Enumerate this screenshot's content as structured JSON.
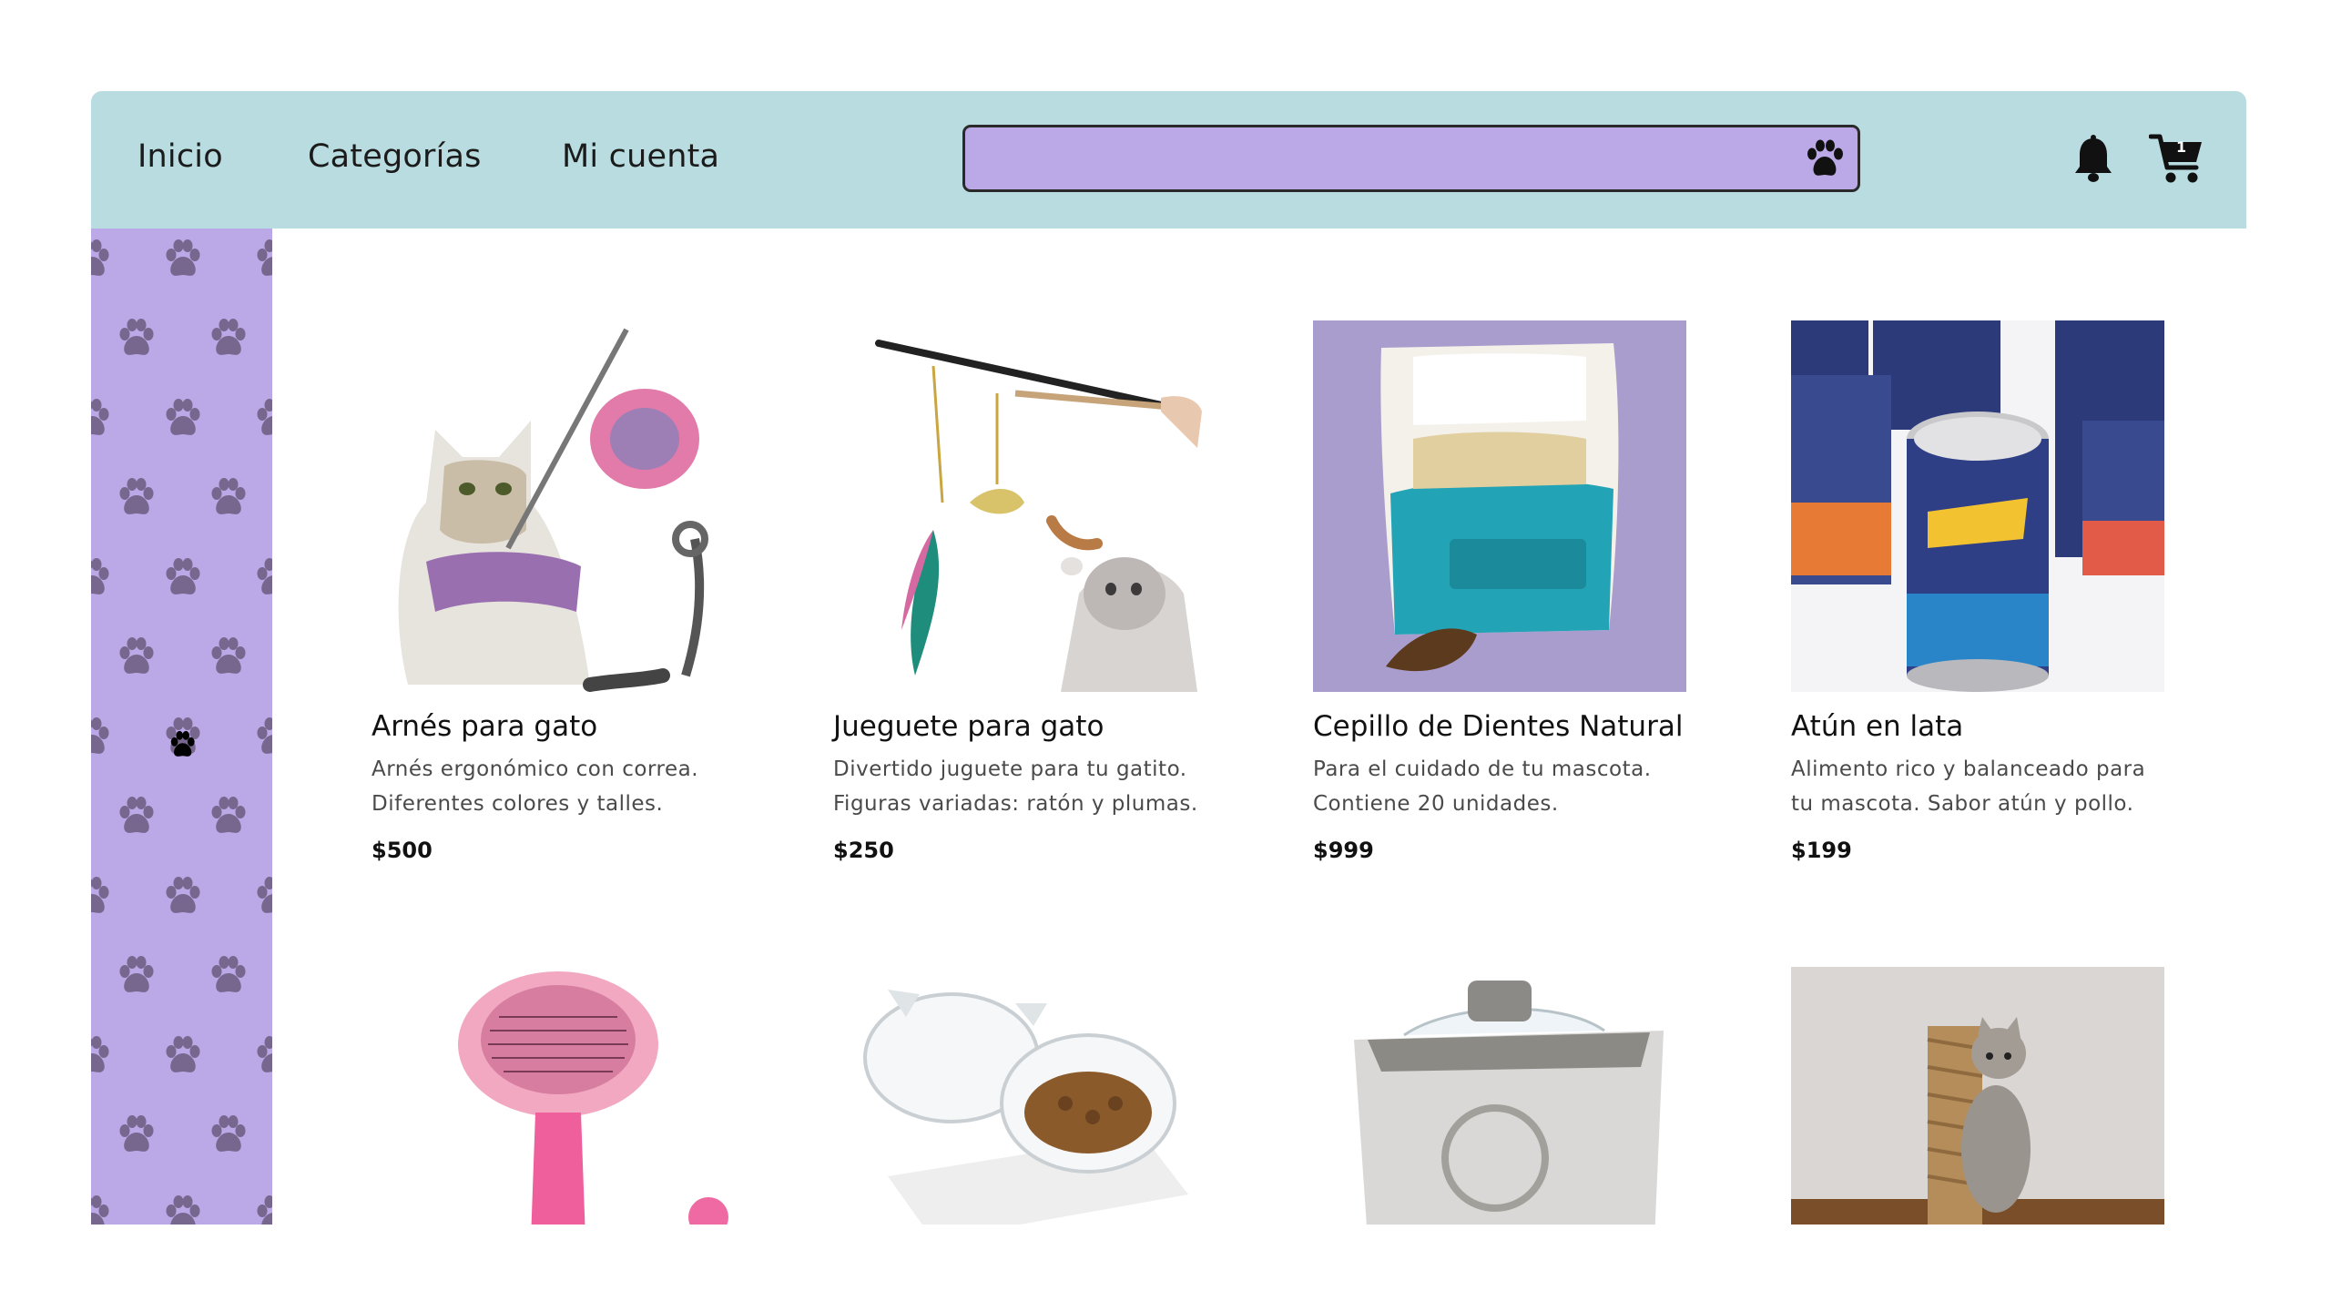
{
  "nav": {
    "items": [
      {
        "label": "Inicio"
      },
      {
        "label": "Categorías"
      },
      {
        "label": "Mi cuenta"
      }
    ]
  },
  "search": {
    "value": "",
    "placeholder": "",
    "button_icon": "paw-icon"
  },
  "header_icons": {
    "notifications": "bell-icon",
    "cart": "cart-icon",
    "cart_count": "1"
  },
  "sidebar": {
    "pattern_icon": "paw-icon"
  },
  "colors": {
    "header": "#b8dce0",
    "sidebar": "#bba8e6",
    "search": "#bba8e6"
  },
  "products": [
    {
      "title": "Arnés para gato",
      "desc1": "Arnés ergonómico con correa.",
      "desc2": "Diferentes colores y talles.",
      "price": "$500",
      "image": "cat-harness-photo"
    },
    {
      "title": "Jueguete para gato",
      "desc1": "Divertido juguete para tu gatito.",
      "desc2": "Figuras variadas: ratón y plumas.",
      "price": "$250",
      "image": "cat-wand-toy-photo"
    },
    {
      "title": "Cepillo de Dientes Natural",
      "desc1": "Para el cuidado de tu mascota.",
      "desc2": "Contiene 20 unidades.",
      "price": "$999",
      "image": "dental-treats-bag-photo"
    },
    {
      "title": "Atún en lata",
      "desc1": "Alimento rico y balanceado para",
      "desc2": "tu mascota. Sabor atún y pollo.",
      "price": "$199",
      "image": "tuna-cans-photo"
    },
    {
      "image": "pink-grooming-brush-photo"
    },
    {
      "image": "cat-food-bowls-photo"
    },
    {
      "image": "water-fountain-photo"
    },
    {
      "image": "kitten-scratching-post-photo"
    }
  ]
}
